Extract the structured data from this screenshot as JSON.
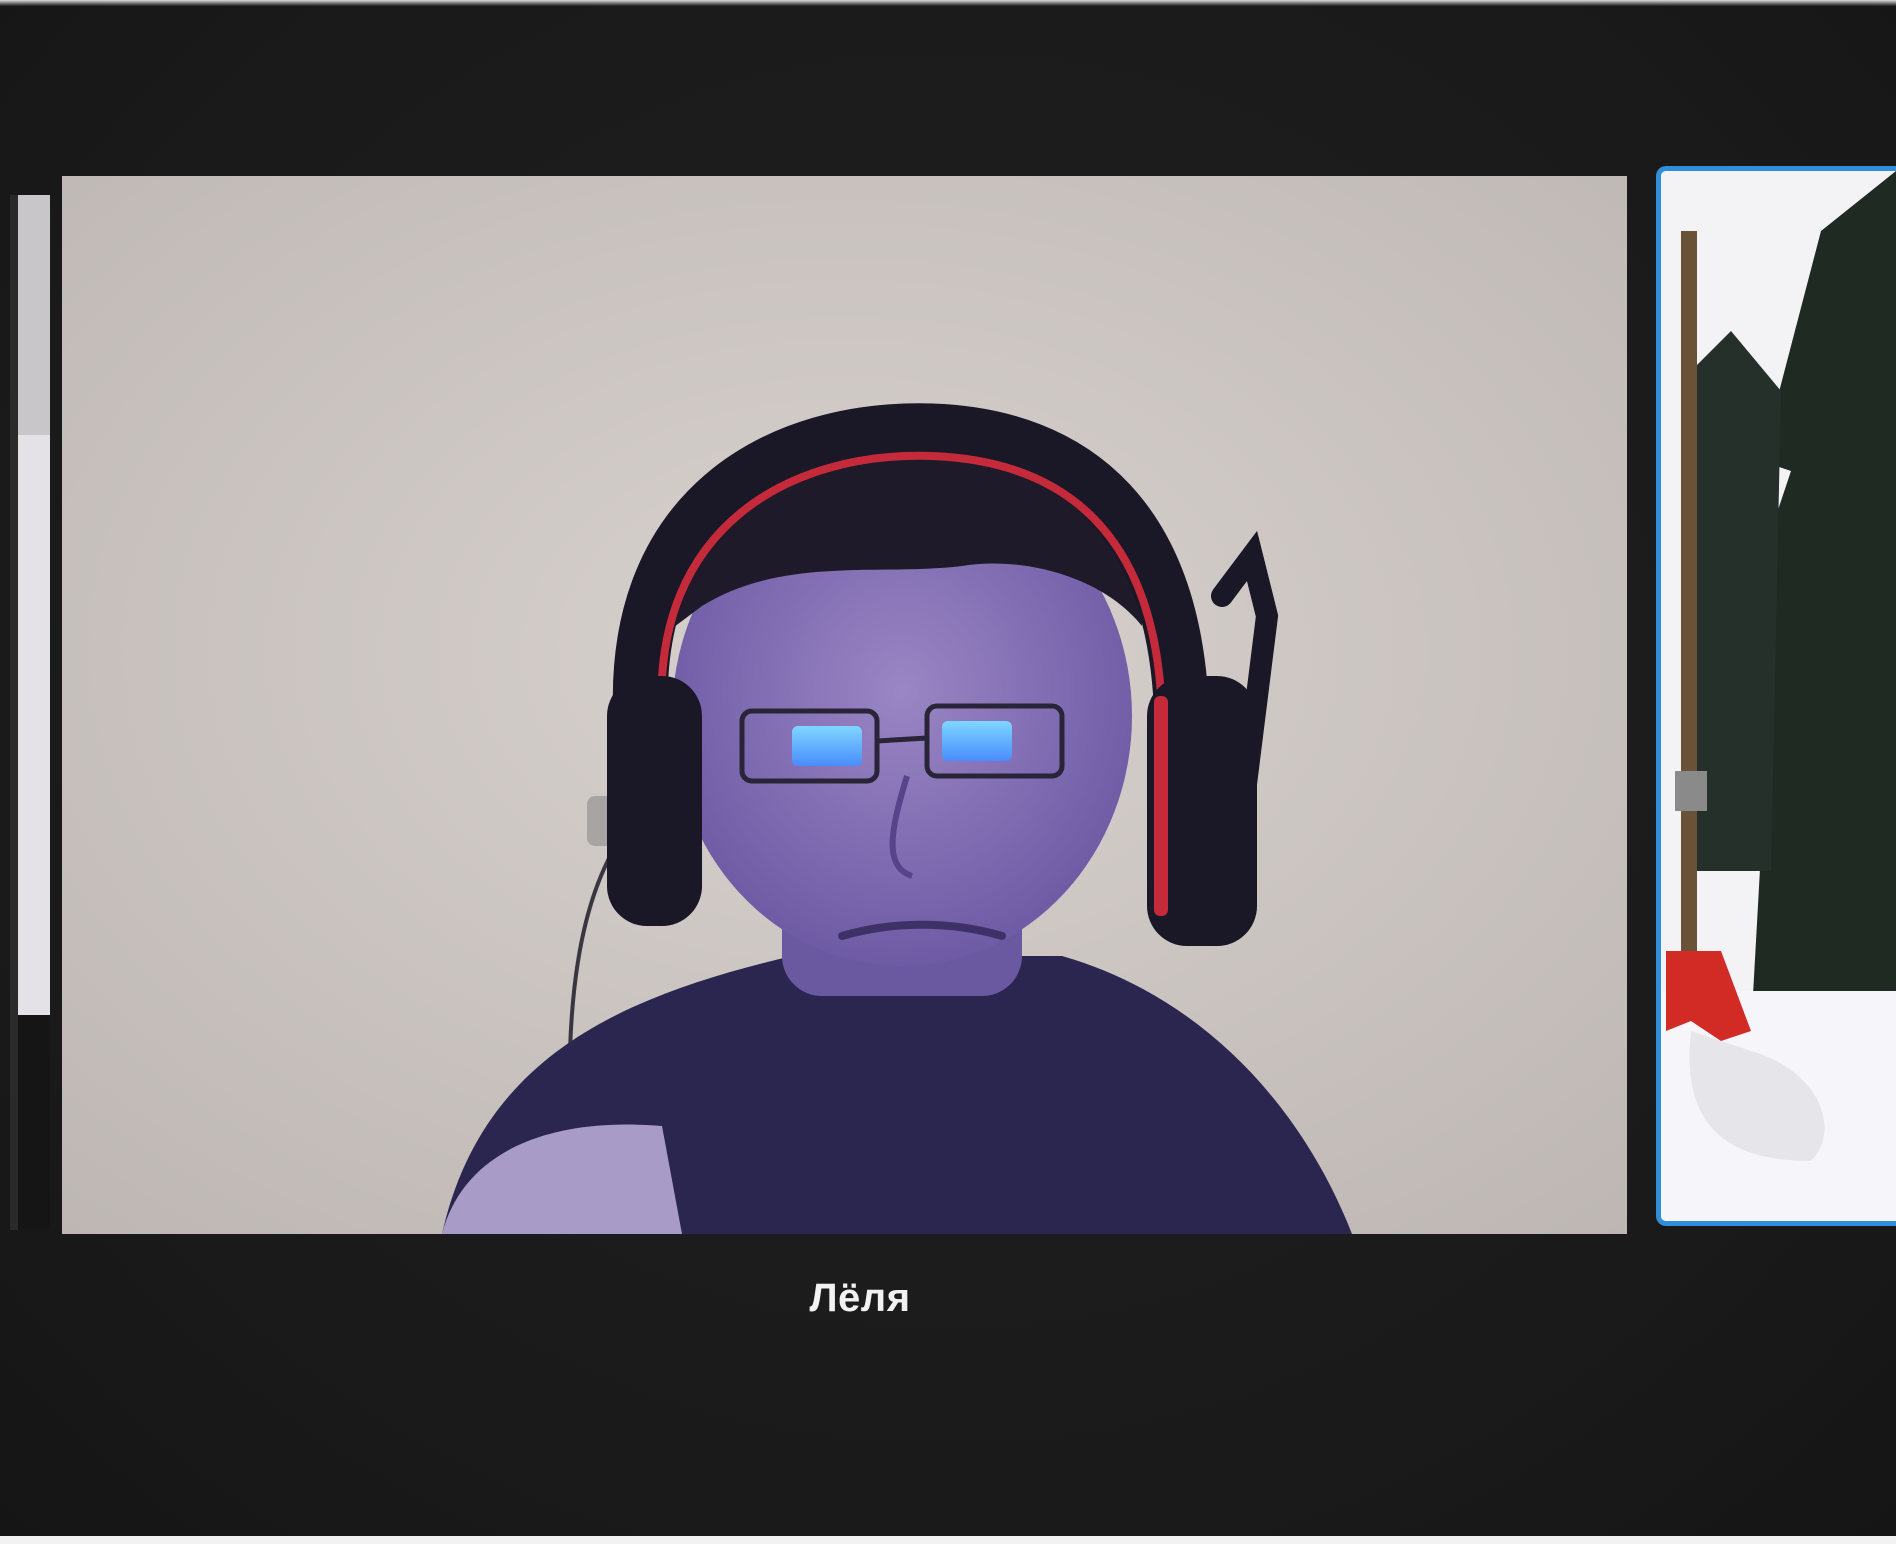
{
  "call": {
    "active_speaker_name": "Лёля",
    "accent_color": "#2f8fdb",
    "background_color": "#1c1c1c"
  },
  "tiles": [
    {
      "role": "left-partial-participant",
      "content": "video-feed"
    },
    {
      "role": "main-speaker",
      "name": "Лёля",
      "content": "video-feed"
    },
    {
      "role": "right-partial-participant",
      "content": "video-feed",
      "highlighted": true
    }
  ]
}
